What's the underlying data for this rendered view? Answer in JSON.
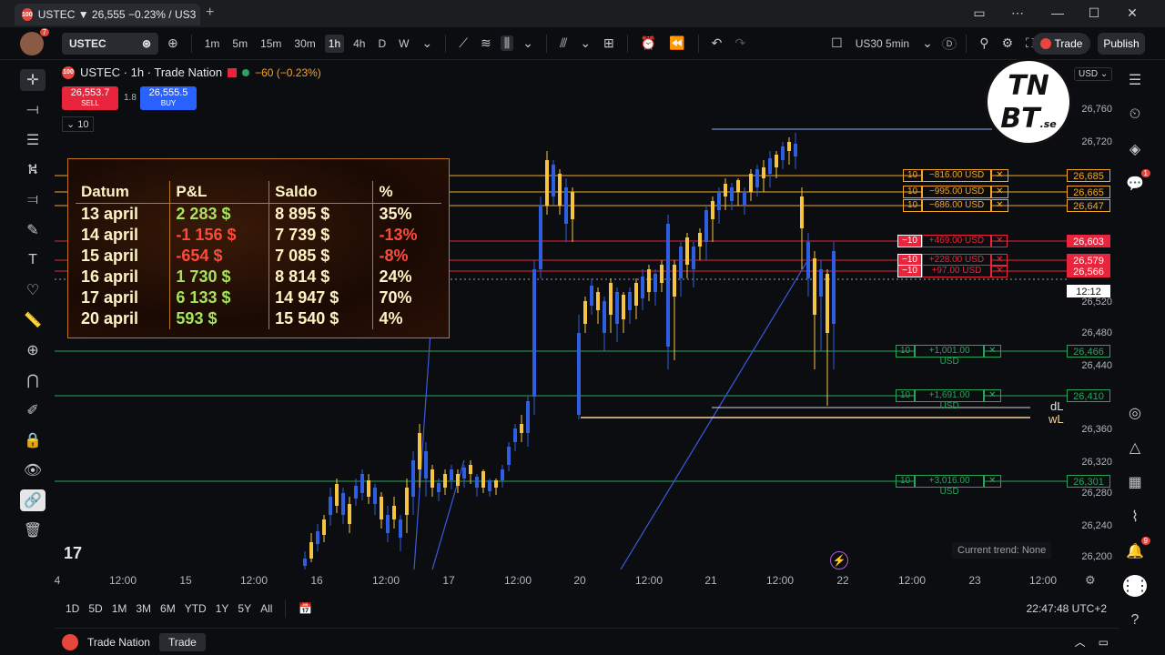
{
  "browser": {
    "tab_title": "USTEC ▼ 26,555 −0.23% / US3",
    "tab_icon": "100",
    "new_tab": "+",
    "window_controls": [
      "⋯",
      "—",
      "☐",
      "✕"
    ]
  },
  "toolbar": {
    "avatar_badge": "7",
    "symbol": "USTEC",
    "intervals": [
      "1m",
      "5m",
      "15m",
      "30m",
      "1h",
      "4h",
      "D",
      "W"
    ],
    "active_interval": "1h",
    "layout_symbol": "US30 5min",
    "layout_badge": "D",
    "trade_label": "Trade",
    "publish_label": "Publish"
  },
  "legend": {
    "title": "USTEC · 1h · Trade Nation",
    "change": "−60 (−0.23%)",
    "sell_price": "26,553.7",
    "sell_label": "SELL",
    "spread": "1.8",
    "buy_price": "26,555.5",
    "buy_label": "BUY",
    "qty": "10",
    "currency": "USD"
  },
  "pnl_table": {
    "headers": [
      "Datum",
      "P&L",
      "Saldo",
      "%"
    ],
    "rows": [
      {
        "date": "13 april",
        "pl": "2 283 $",
        "saldo": "8 895 $",
        "pct": "35%",
        "pos": true
      },
      {
        "date": "14 april",
        "pl": "-1 156 $",
        "saldo": "7 739 $",
        "pct": "-13%",
        "pos": false
      },
      {
        "date": "15 april",
        "pl": "-654 $",
        "saldo": "7 085 $",
        "pct": "-8%",
        "pos": false
      },
      {
        "date": "16 april",
        "pl": "1 730 $",
        "saldo": "8 814 $",
        "pct": "24%",
        "pos": true
      },
      {
        "date": "17 april",
        "pl": "6 133 $",
        "saldo": "14 947 $",
        "pct": "70%",
        "pos": true
      },
      {
        "date": "20 april",
        "pl": "593 $",
        "saldo": "15 540 $",
        "pct": "4%",
        "pos": true
      }
    ]
  },
  "price_axis": {
    "labels": [
      "26,760",
      "26,720",
      "26,520",
      "26,480",
      "26,440",
      "26,360",
      "26,320",
      "26,280",
      "26,240",
      "26,200"
    ],
    "boxes": [
      {
        "text": "26,685",
        "color": "#f5a623"
      },
      {
        "text": "26,665",
        "color": "#f5a623"
      },
      {
        "text": "26,647",
        "color": "#f5a623"
      },
      {
        "text": "26,603",
        "color": "#e8253c"
      },
      {
        "text": "26,579",
        "color": "#e8253c"
      },
      {
        "text": "26,566",
        "color": "#e8253c"
      },
      {
        "text": "12:12",
        "color": "#ffffff"
      },
      {
        "text": "26,466",
        "color": "#26a65b"
      },
      {
        "text": "26,410",
        "color": "#26a65b"
      },
      {
        "text": "26,301",
        "color": "#26a65b"
      }
    ]
  },
  "orders": [
    {
      "qty": "10",
      "text": "−816.00 USD",
      "color": "#f5a623"
    },
    {
      "qty": "10",
      "text": "−995.00 USD",
      "color": "#f5a623"
    },
    {
      "qty": "10",
      "text": "−686.00 USD",
      "color": "#f5a623"
    },
    {
      "qty": "−10",
      "text": "+469.00 USD",
      "color": "#e8253c"
    },
    {
      "qty": "−10",
      "text": "+228.00 USD",
      "color": "#e8253c"
    },
    {
      "qty": "−10",
      "text": "+97.00 USD",
      "color": "#e8253c"
    },
    {
      "qty": "10",
      "text": "+1,001.00 USD",
      "color": "#26a65b"
    },
    {
      "qty": "10",
      "text": "+1,691.00 USD",
      "color": "#26a65b"
    },
    {
      "qty": "10",
      "text": "+3,016.00 USD",
      "color": "#26a65b"
    }
  ],
  "line_tags": {
    "dl": "dL",
    "wl": "wL"
  },
  "trend_text": "Current trend: None",
  "time_axis": [
    "4",
    "12:00",
    "15",
    "12:00",
    "16",
    "12:00",
    "17",
    "12:00",
    "20",
    "12:00",
    "21",
    "12:00",
    "22",
    "12:00",
    "23",
    "12:00"
  ],
  "range_buttons": [
    "1D",
    "5D",
    "1M",
    "3M",
    "6M",
    "YTD",
    "1Y",
    "5Y",
    "All"
  ],
  "clock": "22:47:48 UTC+2",
  "statusbar": {
    "broker": "Trade Nation",
    "trade": "Trade"
  },
  "logo": {
    "line1": "TN",
    "line2": "BT",
    "suffix": ".se"
  },
  "tv_logo": "17",
  "notification_badges": {
    "alerts": "1",
    "bell": "9"
  }
}
